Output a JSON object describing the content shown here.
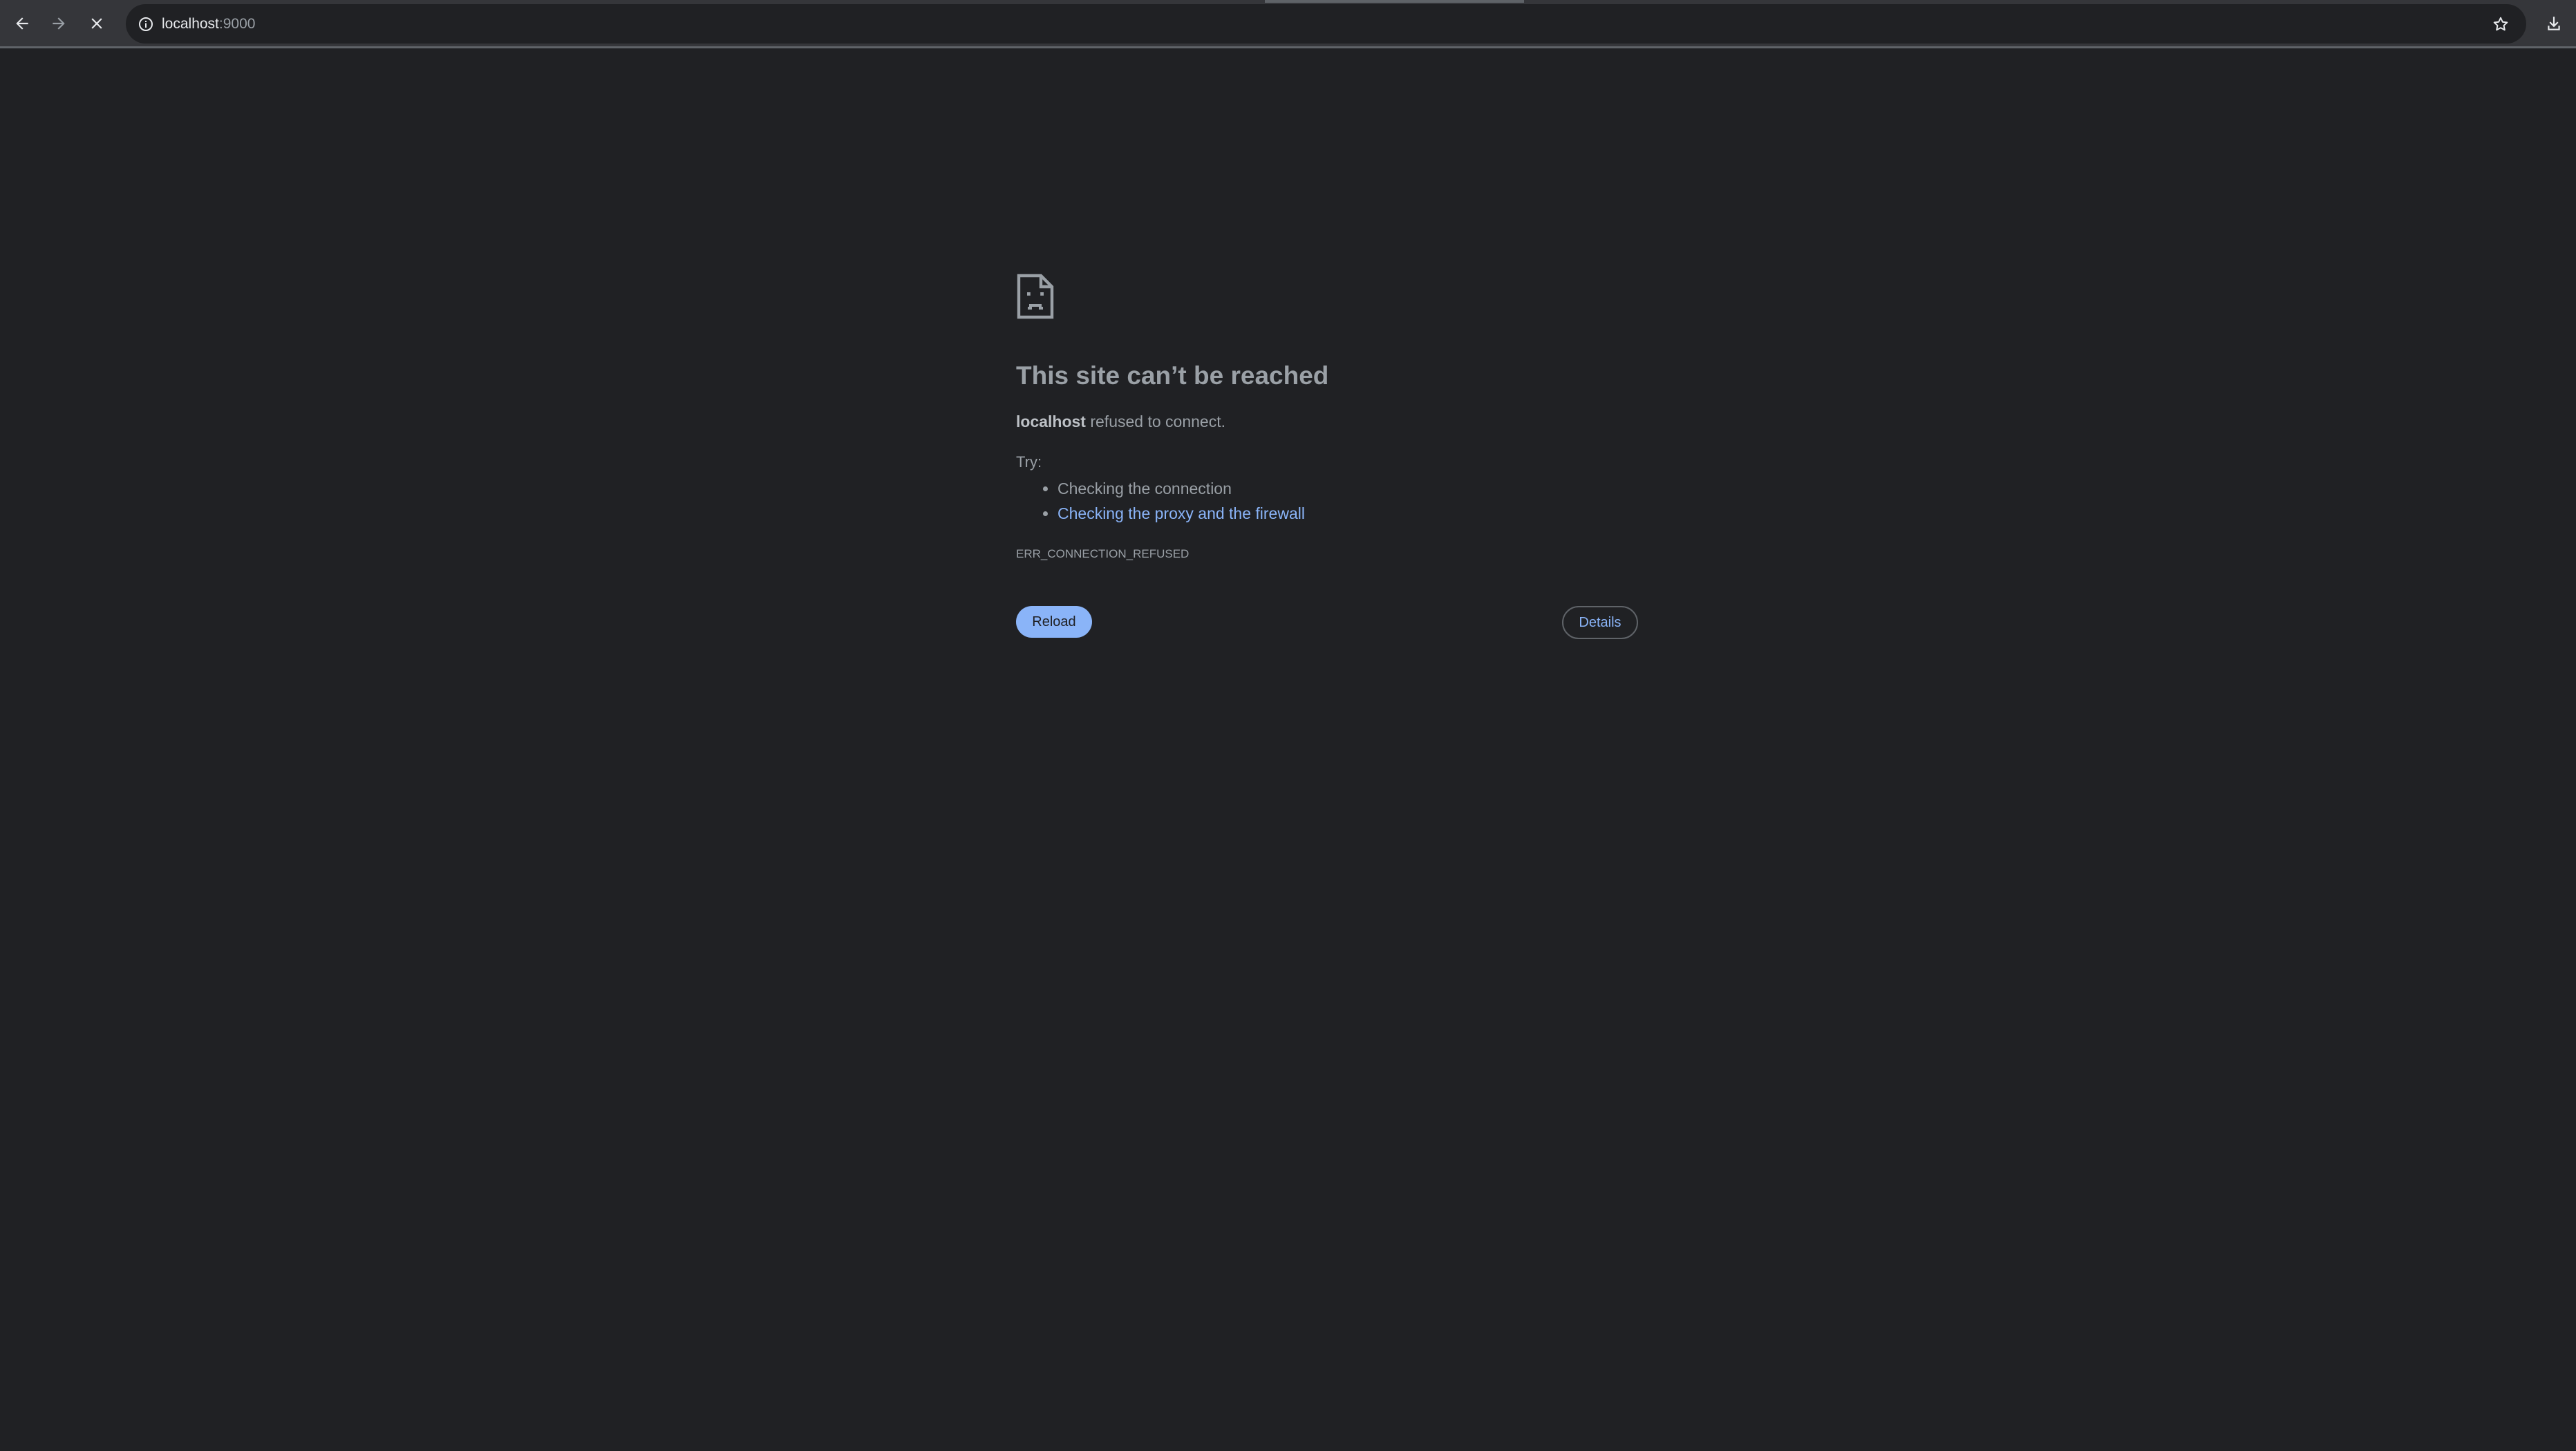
{
  "browser": {
    "url_host": "localhost",
    "url_port": ":9000",
    "icons": {
      "back": "arrow-left-icon",
      "forward": "arrow-right-icon",
      "stop": "close-icon",
      "site_info": "info-icon",
      "bookmark": "star-icon",
      "downloads": "download-icon"
    }
  },
  "error": {
    "icon": "sad-document-icon",
    "title": "This site can’t be reached",
    "host": "localhost",
    "summary_suffix": " refused to connect.",
    "try_label": "Try:",
    "suggestions": [
      "Checking the connection",
      "Checking the proxy and the firewall"
    ],
    "code": "ERR_CONNECTION_REFUSED",
    "reload_label": "Reload",
    "details_label": "Details"
  },
  "colors": {
    "background": "#202124",
    "toolbar": "#35363a",
    "accent": "#8ab4f8",
    "text": "#9aa0a6"
  }
}
